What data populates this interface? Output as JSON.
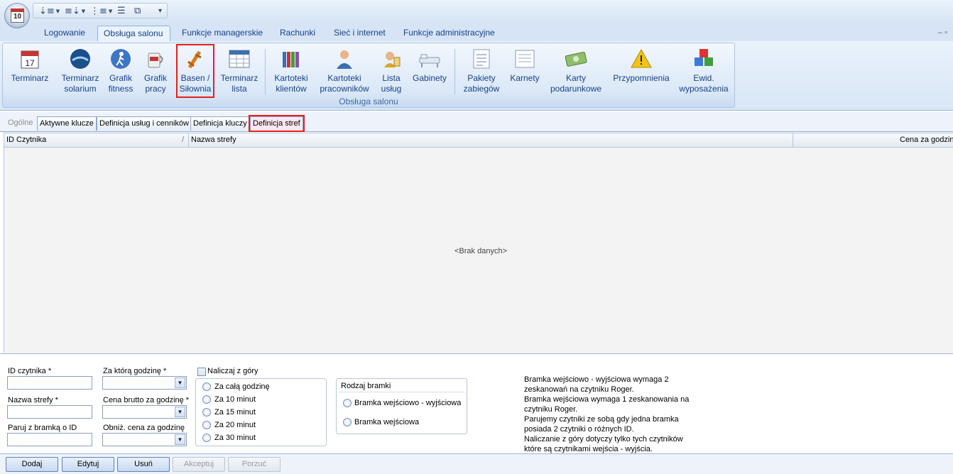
{
  "app": {
    "orb_label": "10"
  },
  "quick_access": {
    "buttons": [
      {
        "name": "sort-ascending-icon",
        "glyph": "⇣≡"
      },
      {
        "name": "sort-descending-icon",
        "glyph": "≡⇣"
      },
      {
        "name": "indent-icon",
        "glyph": "⋮≡"
      },
      {
        "name": "list-icon",
        "glyph": "☰"
      },
      {
        "name": "layout-icon",
        "glyph": "⧉"
      }
    ],
    "customize_glyph": "▾"
  },
  "ribbon_tabs": [
    {
      "label": "Logowanie"
    },
    {
      "label": "Obsługa salonu",
      "active": true
    },
    {
      "label": "Funkcje managerskie"
    },
    {
      "label": "Rachunki"
    },
    {
      "label": "Sieć i internet"
    },
    {
      "label": "Funkcje administracyjne"
    }
  ],
  "window_controls": "–  ▫",
  "ribbon": {
    "group_label": "Obsługa salonu",
    "buttons": [
      {
        "line1": "Terminarz",
        "line2": "",
        "icon": "calendar-icon"
      },
      {
        "line1": "Terminarz",
        "line2": "solarium",
        "icon": "solarium-icon"
      },
      {
        "line1": "Grafik",
        "line2": "fitness",
        "icon": "fitness-icon"
      },
      {
        "line1": "Grafik",
        "line2": "pracy",
        "icon": "work-mug-icon"
      },
      {
        "line1": "Basen /",
        "line2": "Siłownia",
        "icon": "pool-gym-icon",
        "highlighted": true
      },
      {
        "line1": "Terminarz",
        "line2": "lista",
        "icon": "table-list-icon"
      },
      {
        "line1": "Kartoteki",
        "line2": "klientów",
        "icon": "client-files-icon"
      },
      {
        "line1": "Kartoteki",
        "line2": "pracowników",
        "icon": "employee-icon"
      },
      {
        "line1": "Lista",
        "line2": "usług",
        "icon": "services-icon"
      },
      {
        "line1": "Gabinety",
        "line2": "",
        "icon": "rooms-icon"
      },
      {
        "line1": "Pakiety",
        "line2": "zabiegów",
        "icon": "packages-icon"
      },
      {
        "line1": "Karnety",
        "line2": "",
        "icon": "passes-icon"
      },
      {
        "line1": "Karty",
        "line2": "podarunkowe",
        "icon": "gift-card-icon"
      },
      {
        "line1": "Przypomnienia",
        "line2": "",
        "icon": "warning-icon"
      },
      {
        "line1": "Ewid.",
        "line2": "wyposażenia",
        "icon": "equipment-icon"
      }
    ]
  },
  "sub_tabs": [
    {
      "label": "Ogólne",
      "dim": true
    },
    {
      "label": "Aktywne klucze"
    },
    {
      "label": "Definicja usług i cenników"
    },
    {
      "label": "Definicja kluczy"
    },
    {
      "label": "Definicja stref",
      "selected": true
    }
  ],
  "grid": {
    "columns": [
      "ID Czytnika",
      "Nazwa strefy",
      "Cena za godzinę"
    ],
    "sort_glyph": "/",
    "empty_text": "<Brak danych>"
  },
  "form": {
    "reader_id_label": "ID czytnika *",
    "reader_id_value": "",
    "zone_name_label": "Nazwa strefy *",
    "zone_name_value": "",
    "pair_label": "Paruj z bramką o ID",
    "pair_value": "",
    "hour_label": "Za którą godzinę *",
    "price_label": "Cena brutto za godzinę *",
    "discount_label": "Obniż. cena za godzinę",
    "charge_upfront_label": "Naliczaj z góry",
    "charge_options": [
      "Za całą godzinę",
      "Za 10 minut",
      "Za 15 minut",
      "Za 20 minut",
      "Za 30 minut"
    ],
    "gate_type_title": "Rodzaj bramki",
    "gate_options": [
      "Bramka wejściowo - wyjściowa",
      "Bramka wejściowa"
    ],
    "info_lines": [
      "Bramka wejściowo - wyjściowa wymaga 2",
      "zeskanowań na czytniku Roger.",
      "Bramka wejściowa wymaga 1 zeskanowania na",
      "czytniku Roger.",
      "Parujemy czytniki ze sobą gdy jedna bramka",
      "posiada 2 czytniki o różnych ID.",
      "Naliczanie z góry dotyczy tylko tych czytników",
      "które są czytnikami wejścia - wyjścia."
    ]
  },
  "actions": {
    "add": "Dodaj",
    "edit": "Edytuj",
    "delete": "Usuń",
    "accept": "Akceptuj",
    "discard": "Porzuć"
  },
  "colors": {
    "highlight": "#e02020",
    "ribbon_text": "#15428b"
  }
}
